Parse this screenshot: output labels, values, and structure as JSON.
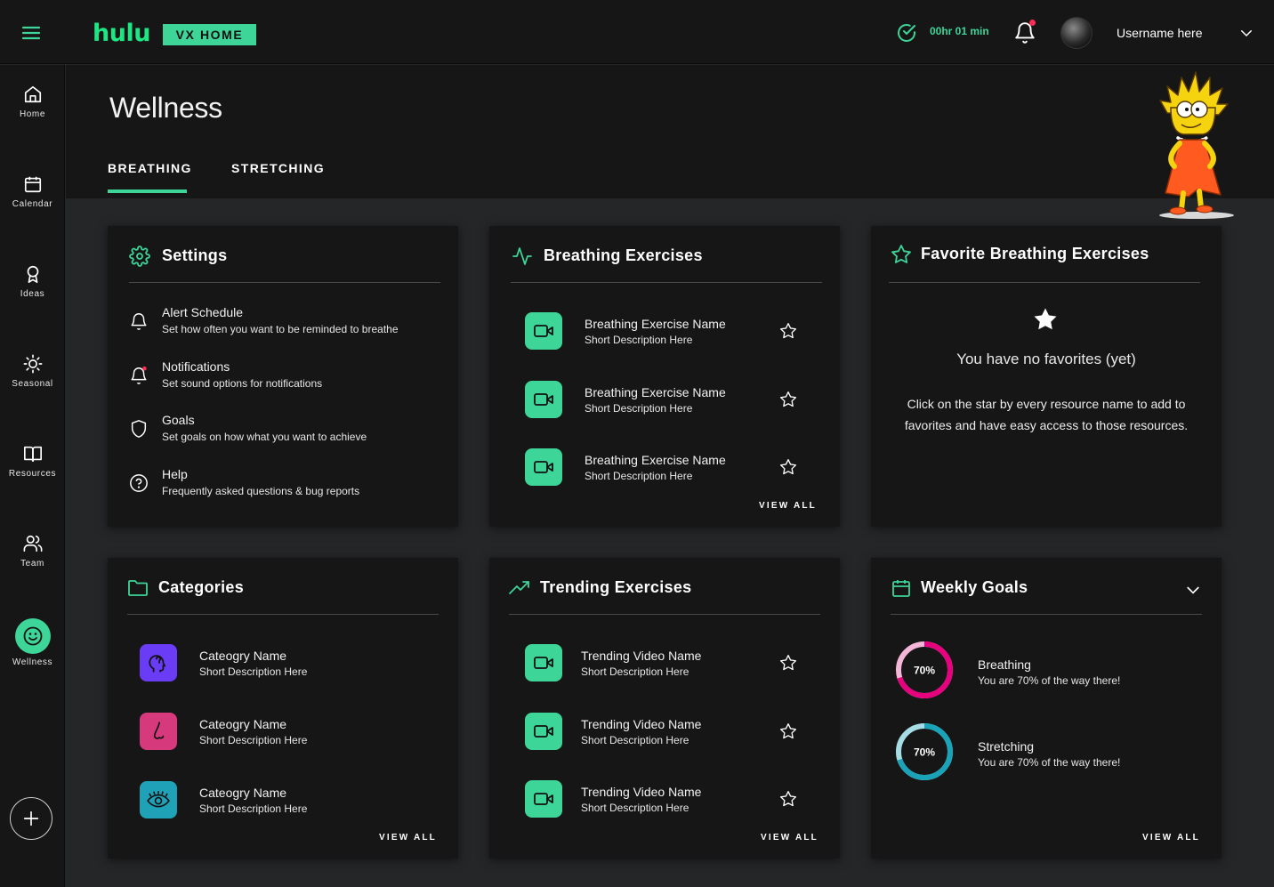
{
  "app": {
    "logo": "hulu",
    "badge": "VX HOME",
    "timer": "00hr 01 min",
    "username": "Username here"
  },
  "sidebar": {
    "items": [
      {
        "label": "Home",
        "icon": "home-icon"
      },
      {
        "label": "Calendar",
        "icon": "calendar-icon"
      },
      {
        "label": "Ideas",
        "icon": "award-icon"
      },
      {
        "label": "Seasonal",
        "icon": "sun-icon"
      },
      {
        "label": "Resources",
        "icon": "book-icon"
      },
      {
        "label": "Team",
        "icon": "team-icon"
      },
      {
        "label": "Wellness",
        "icon": "smile-icon",
        "active": true
      }
    ]
  },
  "page": {
    "title": "Wellness",
    "tabs": [
      {
        "label": "BREATHING",
        "active": true
      },
      {
        "label": "STRETCHING",
        "active": false
      }
    ]
  },
  "settings": {
    "title": "Settings",
    "items": [
      {
        "title": "Alert Schedule",
        "desc": "Set how often you want to be reminded to breathe"
      },
      {
        "title": "Notifications",
        "desc": "Set sound options for notifications"
      },
      {
        "title": "Goals",
        "desc": "Set goals on how what you want to achieve"
      },
      {
        "title": "Help",
        "desc": "Frequently asked questions & bug reports"
      }
    ]
  },
  "breathing": {
    "title": "Breathing Exercises",
    "items": [
      {
        "name": "Breathing Exercise Name",
        "desc": "Short Description Here"
      },
      {
        "name": "Breathing Exercise Name",
        "desc": "Short Description Here"
      },
      {
        "name": "Breathing Exercise Name",
        "desc": "Short Description Here"
      }
    ],
    "view_all": "VIEW ALL"
  },
  "favorites": {
    "title": "Favorite Breathing Exercises",
    "empty_title": "You have no favorites (yet)",
    "empty_desc": "Click on the star by every resource name to add to favorites and have easy access to those resources."
  },
  "categories": {
    "title": "Categories",
    "items": [
      {
        "name": "Cateogry Name",
        "desc": "Short Description Here",
        "color": "#6b3cf5",
        "icon": "head-icon"
      },
      {
        "name": "Cateogry Name",
        "desc": "Short Description Here",
        "color": "#d63a7c",
        "icon": "nose-icon"
      },
      {
        "name": "Cateogry Name",
        "desc": "Short Description Here",
        "color": "#1fa2b8",
        "icon": "eye-icon"
      }
    ],
    "view_all": "VIEW ALL"
  },
  "trending": {
    "title": "Trending Exercises",
    "items": [
      {
        "name": "Trending Video Name",
        "desc": "Short Description Here"
      },
      {
        "name": "Trending Video Name",
        "desc": "Short Description Here"
      },
      {
        "name": "Trending Video Name",
        "desc": "Short Description Here"
      }
    ],
    "view_all": "VIEW ALL"
  },
  "goals": {
    "title": "Weekly Goals",
    "items": [
      {
        "name": "Breathing",
        "desc": "You are 70% of the way there!",
        "percent": 70,
        "label": "70%",
        "color": "#e6007e",
        "track": "#f4b6d6"
      },
      {
        "name": "Stretching",
        "desc": "You are 70% of the way there!",
        "percent": 70,
        "label": "70%",
        "color": "#1aa3b8",
        "track": "#a6dde5"
      }
    ],
    "view_all": "VIEW ALL"
  },
  "colors": {
    "accent": "#3dd598",
    "background": "#252628",
    "surface": "#161617"
  }
}
